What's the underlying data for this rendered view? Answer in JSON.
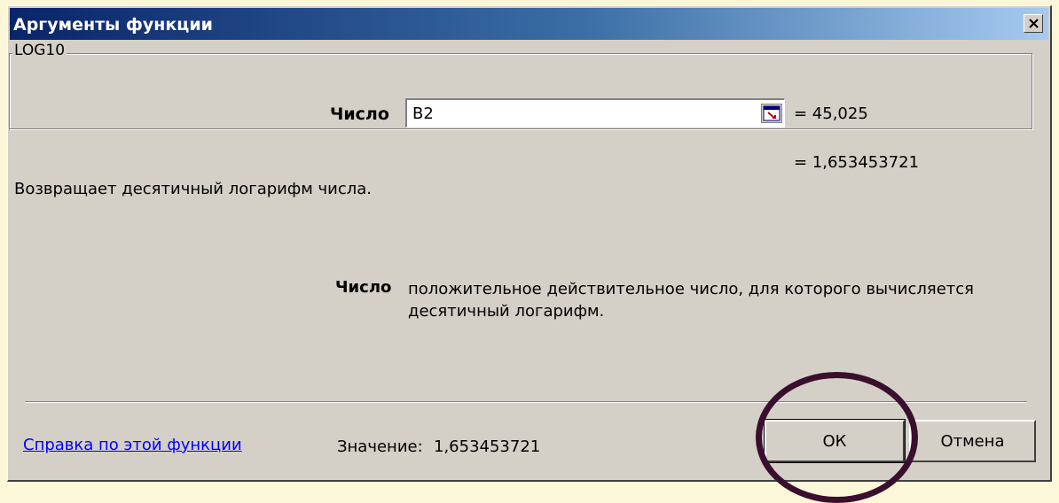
{
  "dialog": {
    "title": "Аргументы функции",
    "close_icon": "close-x-icon",
    "group_label": "LOG10",
    "argument": {
      "label": "Число",
      "input_value": "B2",
      "ref_icon": "collapse-dialog-icon",
      "value": "= 45,025"
    },
    "result": "= 1,653453721",
    "description": "Возвращает десятичный логарифм числа.",
    "help": {
      "name": "Число",
      "text": "положительное действительное число, для которого вычисляется десятичный логарифм."
    },
    "footer": {
      "help_link": "Справка по этой функции",
      "value_label": "Значение:",
      "value_number": "1,653453721",
      "ok_label": "ОК",
      "cancel_label": "Отмена"
    }
  },
  "colors": {
    "slide_background": "#fdf7d9",
    "dialog_face": "#d4d0c8",
    "titlebar_start": "#0a246a",
    "titlebar_end": "#a6caf0",
    "highlight_circle": "#3a0f2e",
    "link": "#0000ff"
  }
}
